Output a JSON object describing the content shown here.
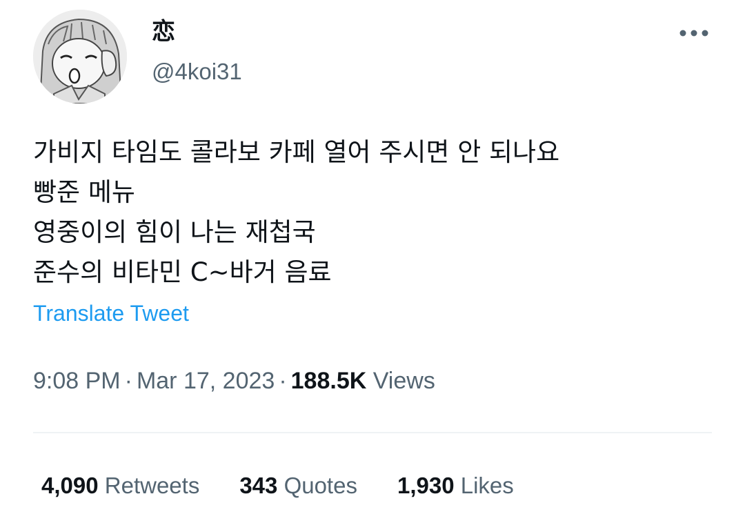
{
  "author": {
    "display_name": "恋",
    "handle": "@4koi31"
  },
  "tweet": {
    "lines": [
      "가비지 타임도 콜라보 카페 열어 주시면 안 되나요",
      "빵준 메뉴",
      "영중이의 힘이 나는 재첩국",
      "준수의 비타민 C~바거 음료"
    ],
    "translate_label": "Translate Tweet"
  },
  "meta": {
    "time": "9:08 PM",
    "separator": "·",
    "date": "Mar 17, 2023",
    "views_count": "188.5K",
    "views_label": "Views"
  },
  "stats": {
    "retweets_count": "4,090",
    "retweets_label": "Retweets",
    "quotes_count": "343",
    "quotes_label": "Quotes",
    "likes_count": "1,930",
    "likes_label": "Likes"
  },
  "icons": {
    "more": "more-horizontal-icon"
  },
  "colors": {
    "link": "#1d9bf0",
    "secondary_text": "#536471",
    "primary_text": "#0f1419",
    "divider": "#eff3f4"
  }
}
